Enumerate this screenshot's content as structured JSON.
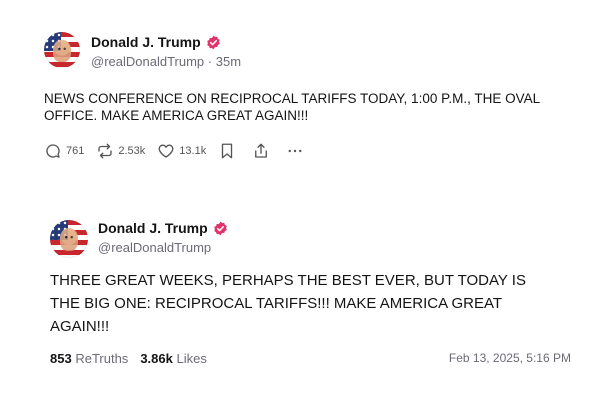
{
  "post1": {
    "author": "Donald J. Trump",
    "handle": "@realDonaldTrump",
    "separator": "·",
    "time": "35m",
    "text": "NEWS CONFERENCE ON RECIPROCAL TARIFFS TODAY, 1:00 P.M., THE OVAL\nOFFICE. MAKE AMERICA GREAT AGAIN!!!",
    "replies": "761",
    "retruths": "2.53k",
    "likes": "13.1k",
    "icons": [
      "reply-icon",
      "retruth-icon",
      "heart-icon",
      "bookmark-icon",
      "share-icon",
      "more-icon"
    ]
  },
  "post2": {
    "author": "Donald J. Trump",
    "handle": "@realDonaldTrump",
    "text": "THREE GREAT WEEKS, PERHAPS THE BEST EVER, BUT TODAY IS\nTHE BIG ONE: RECIPROCAL TARIFFS!!! MAKE AMERICA GREAT\nAGAIN!!!",
    "retruths_count": "853",
    "retruths_label": "ReTruths",
    "likes_count": "3.86k",
    "likes_label": "Likes",
    "date": "Feb 13, 2025, 5:16 PM"
  },
  "colors": {
    "verified_badge": "#e2336b",
    "text": "#141414",
    "muted": "#6b6b75"
  }
}
